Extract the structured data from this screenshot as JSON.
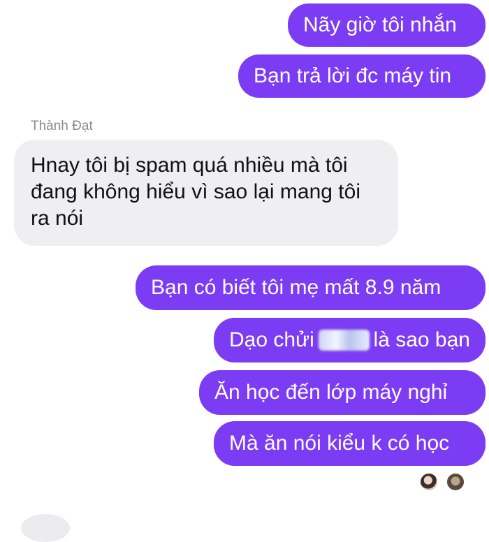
{
  "conversation": {
    "sender_name": "Thành Đạt",
    "messages": [
      {
        "direction": "out",
        "text": "Nãy giờ tôi nhắn"
      },
      {
        "direction": "out",
        "text": "Bạn trả lời đc máy tin"
      },
      {
        "direction": "in",
        "text": "Hnay tôi bị spam quá nhiều mà tôi đang không hiểu vì sao lại mang tôi ra nói"
      },
      {
        "direction": "out",
        "text": "Bạn có biết tôi mẹ mất 8.9 năm"
      },
      {
        "direction": "out",
        "text_before": "Dạo chửi",
        "text_after": "là sao bạn"
      },
      {
        "direction": "out",
        "text": "Ăn học đến lớp máy nghỉ"
      },
      {
        "direction": "out",
        "text": "Mà ăn nói kiểu k có học"
      }
    ]
  },
  "colors": {
    "outgoing_bubble": "#7c3cf4",
    "incoming_bubble": "#efeff2",
    "sender_name": "#8a8a8e"
  },
  "icons": {
    "read_receipts": [
      "seen-avatar-1",
      "seen-avatar-2"
    ]
  }
}
